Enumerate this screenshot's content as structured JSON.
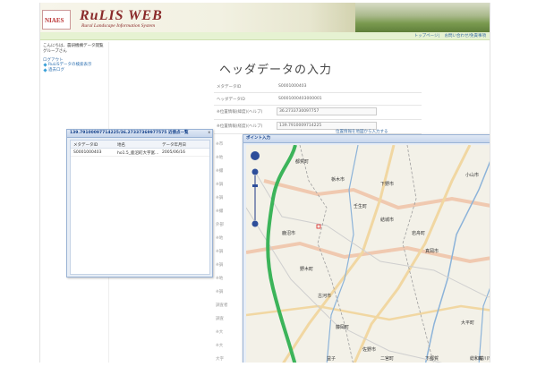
{
  "header": {
    "logo_text": "NIAES",
    "title": "RuLIS WEB",
    "subtitle": "Rural Landscape Information System",
    "links": [
      "トップページ",
      "お問い合わせ/免責事項"
    ]
  },
  "sidebar": {
    "greeting": [
      "こんにちは、農研機構データ閲覧",
      "グループさん"
    ],
    "section": "ログアウト",
    "items": [
      {
        "label": "RuLISデータの検索表示",
        "icon": "diamond-bullet-icon"
      },
      {
        "label": "過去ログ",
        "icon": "diamond-bullet-icon"
      }
    ]
  },
  "main": {
    "heading": "ヘッダデータの入力",
    "fields": [
      {
        "label": "メタデータID",
        "value": "S0001000403",
        "type": "text"
      },
      {
        "label": "ヘッダデータID",
        "value": "S0001000403000001",
        "type": "text"
      },
      {
        "label": "※位置情報(緯度)(ヘルプ)",
        "value": "36.2733730097757",
        "type": "input"
      },
      {
        "label": "※位置情報(経度)(ヘルプ)",
        "value": "139.7910009714225",
        "type": "input"
      }
    ],
    "map_link": "位置情報を地図から入力する",
    "left_labels": [
      "※市",
      "※地",
      "※撮",
      "※調",
      "※調",
      "※撮",
      "外部",
      "※地",
      "※調",
      "※調",
      "※地",
      "※調",
      "調査者",
      "調査",
      "※大",
      "※大",
      "大字",
      "※大"
    ]
  },
  "list_window": {
    "title": "139.79100097714225/36.27337369977575 近傍点一覧",
    "columns": [
      "メタデータID",
      "地名",
      "データ年月日"
    ],
    "rows": [
      {
        "id": "S0001000403",
        "place": "ho1.5_鹿沼町大字富...",
        "date": "2005/06/16"
      }
    ]
  },
  "map_window": {
    "title": "ポイント入力",
    "zoom_labels": [
      "市",
      "県",
      "地"
    ],
    "place_labels": [
      {
        "text": "都賀町"
      },
      {
        "text": "栃木市"
      },
      {
        "text": "下野市"
      },
      {
        "text": "小山市"
      },
      {
        "text": "壬生町"
      },
      {
        "text": "結城市"
      },
      {
        "text": "真岡市"
      },
      {
        "text": "鹿沼市"
      },
      {
        "text": "野木町"
      },
      {
        "text": "古河市"
      },
      {
        "text": "藤岡町"
      },
      {
        "text": "岩舟町"
      },
      {
        "text": "佐野市"
      },
      {
        "text": "大平町"
      },
      {
        "text": "下都賀"
      },
      {
        "text": "総和町"
      },
      {
        "text": "益子"
      },
      {
        "text": "二宮町"
      },
      {
        "text": "桜川市"
      }
    ]
  }
}
